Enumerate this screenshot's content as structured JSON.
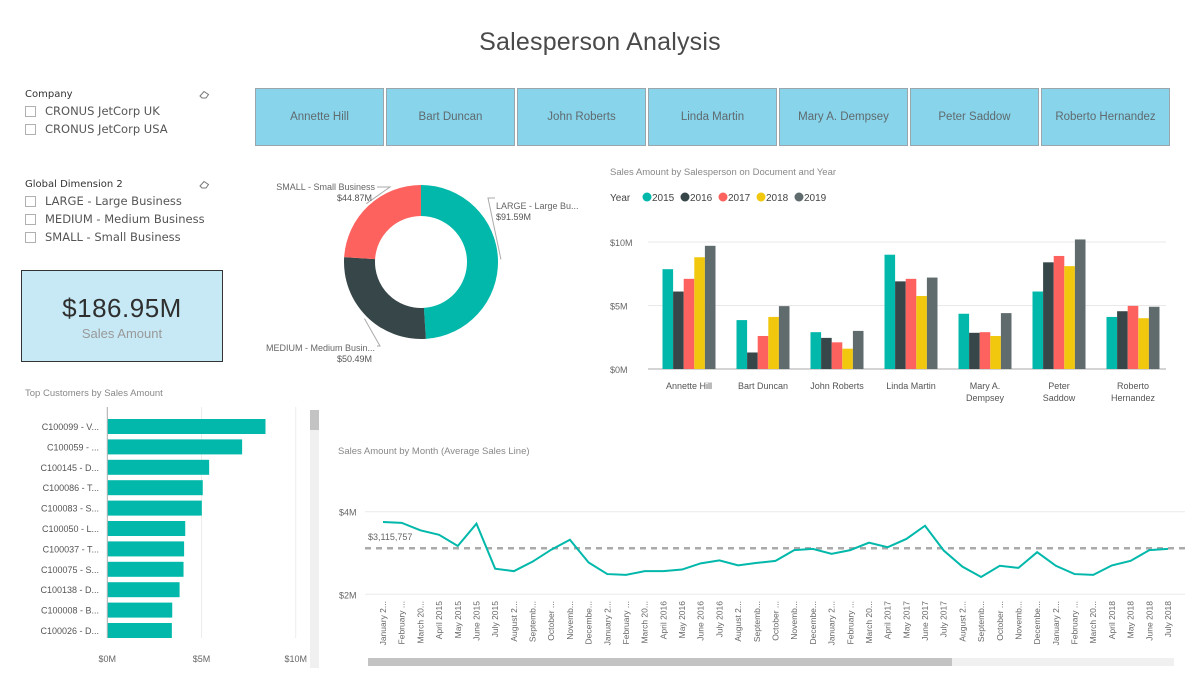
{
  "page": {
    "title": "Salesperson Analysis"
  },
  "slicers": {
    "company": {
      "title": "Company",
      "clear_icon": "eraser-icon",
      "items": [
        "CRONUS JetCorp UK",
        "CRONUS JetCorp USA"
      ]
    },
    "global_dimension_2": {
      "title": "Global Dimension 2",
      "clear_icon": "eraser-icon",
      "items": [
        "LARGE - Large Business",
        "MEDIUM - Medium Business",
        "SMALL - Small Business"
      ]
    }
  },
  "kpi": {
    "value": "$186.95M",
    "label": "Sales Amount"
  },
  "salesperson_tiles": [
    "Annette Hill",
    "Bart Duncan",
    "John Roberts",
    "Linda Martin",
    "Mary A. Dempsey",
    "Peter Saddow",
    "Roberto Hernandez"
  ],
  "colors": {
    "teal": "#01b8aa",
    "dark": "#374649",
    "red": "#fd625e",
    "yellow": "#f2c80f",
    "gray": "#5f6b6d",
    "tile": "#88d4eb",
    "kpi_bg": "#c6e9f5"
  },
  "chart_data": [
    {
      "id": "donut",
      "type": "pie",
      "title": "",
      "donut": true,
      "slices": [
        {
          "label": "LARGE - Large Bu...",
          "value": 91.59,
          "value_label": "$91.59M",
          "color": "#01b8aa"
        },
        {
          "label": "MEDIUM - Medium Busin...",
          "value": 50.49,
          "value_label": "$50.49M",
          "color": "#374649"
        },
        {
          "label": "SMALL - Small Business",
          "value": 44.87,
          "value_label": "$44.87M",
          "color": "#fd625e"
        }
      ]
    },
    {
      "id": "clustered",
      "type": "bar",
      "title": "Sales Amount by Salesperson on Document and Year",
      "legend_title": "Year",
      "legend_position": "top-left",
      "categories": [
        [
          "Annette Hill"
        ],
        [
          "Bart Duncan"
        ],
        [
          "John Roberts"
        ],
        [
          "Linda Martin"
        ],
        [
          "Mary A.",
          "Dempsey"
        ],
        [
          "Peter",
          "Saddow"
        ],
        [
          "Roberto",
          "Hernandez"
        ]
      ],
      "series": [
        {
          "name": "2015",
          "color": "#01b8aa",
          "values": [
            7.86,
            3.85,
            2.9,
            9.0,
            4.35,
            6.1,
            4.1
          ]
        },
        {
          "name": "2016",
          "color": "#374649",
          "values": [
            6.1,
            1.3,
            2.45,
            6.9,
            2.85,
            8.4,
            4.55
          ]
        },
        {
          "name": "2017",
          "color": "#fd625e",
          "values": [
            7.1,
            2.6,
            2.1,
            7.1,
            2.9,
            8.9,
            4.97
          ]
        },
        {
          "name": "2018",
          "color": "#f2c80f",
          "values": [
            8.8,
            4.1,
            1.6,
            5.75,
            2.6,
            8.1,
            4.0
          ]
        },
        {
          "name": "2019",
          "color": "#5f6b6d",
          "values": [
            9.7,
            4.95,
            3.0,
            7.2,
            4.4,
            10.2,
            4.9
          ]
        }
      ],
      "ylim": [
        0,
        10.5
      ],
      "yticks": [
        0,
        5,
        10
      ],
      "ytick_labels": [
        "$0M",
        "$5M",
        "$10M"
      ],
      "grid": true
    },
    {
      "id": "topcustomers",
      "type": "bar",
      "orientation": "horizontal",
      "title": "Top Customers by Sales Amount",
      "categories": [
        "C100099 - V...",
        "C100059 - ...",
        "C100145 - D...",
        "C100086 - T...",
        "C100083 - S...",
        "C100050 - L...",
        "C100037 - T...",
        "C100075 - S...",
        "C100138 - D...",
        "C100008 - B...",
        "C100026 - D..."
      ],
      "values": [
        8.37,
        7.13,
        5.38,
        5.04,
        4.99,
        4.11,
        4.05,
        4.02,
        3.81,
        3.42,
        3.4
      ],
      "color": "#01b8aa",
      "xlim": [
        0,
        10
      ],
      "xticks": [
        0,
        5,
        10
      ],
      "xtick_labels": [
        "$0M",
        "$5M",
        "$10M"
      ],
      "grid": true
    },
    {
      "id": "monthly",
      "type": "line",
      "title": "Sales Amount by Month (Average Sales Line)",
      "x": [
        "January 2...",
        "February ...",
        "March 20...",
        "April 2015",
        "May 2015",
        "June 2015",
        "July 2015",
        "August 2...",
        "Septemb...",
        "October ...",
        "Novemb...",
        "Decembe...",
        "January 2...",
        "February ...",
        "March 20...",
        "April 2016",
        "May 2016",
        "June 2016",
        "July 2016",
        "August 2...",
        "Septemb...",
        "October ...",
        "Novemb...",
        "Decembe...",
        "January 2...",
        "February ...",
        "March 20...",
        "April 2017",
        "May 2017",
        "June 2017",
        "July 2017",
        "August 2...",
        "Septemb...",
        "October ...",
        "Novemb...",
        "Decembe...",
        "January 2...",
        "February ...",
        "March 20...",
        "April 2018",
        "May 2018",
        "June 2018",
        "July 2018"
      ],
      "values": [
        3.75,
        3.73,
        3.55,
        3.44,
        3.17,
        3.71,
        2.62,
        2.56,
        2.79,
        3.08,
        3.32,
        2.77,
        2.49,
        2.47,
        2.56,
        2.56,
        2.6,
        2.75,
        2.82,
        2.7,
        2.76,
        2.81,
        3.07,
        3.1,
        2.98,
        3.07,
        3.25,
        3.14,
        3.34,
        3.66,
        3.06,
        2.67,
        2.42,
        2.69,
        2.64,
        3.02,
        2.69,
        2.49,
        2.47,
        2.7,
        2.81,
        3.07,
        3.1
      ],
      "average": 3.115757,
      "average_label": "$3,115,757",
      "color": "#01b8aa",
      "ylim": [
        1.95,
        4.3
      ],
      "yticks": [
        2,
        4
      ],
      "ytick_labels": [
        "$2M",
        "$4M"
      ],
      "grid": true
    }
  ]
}
